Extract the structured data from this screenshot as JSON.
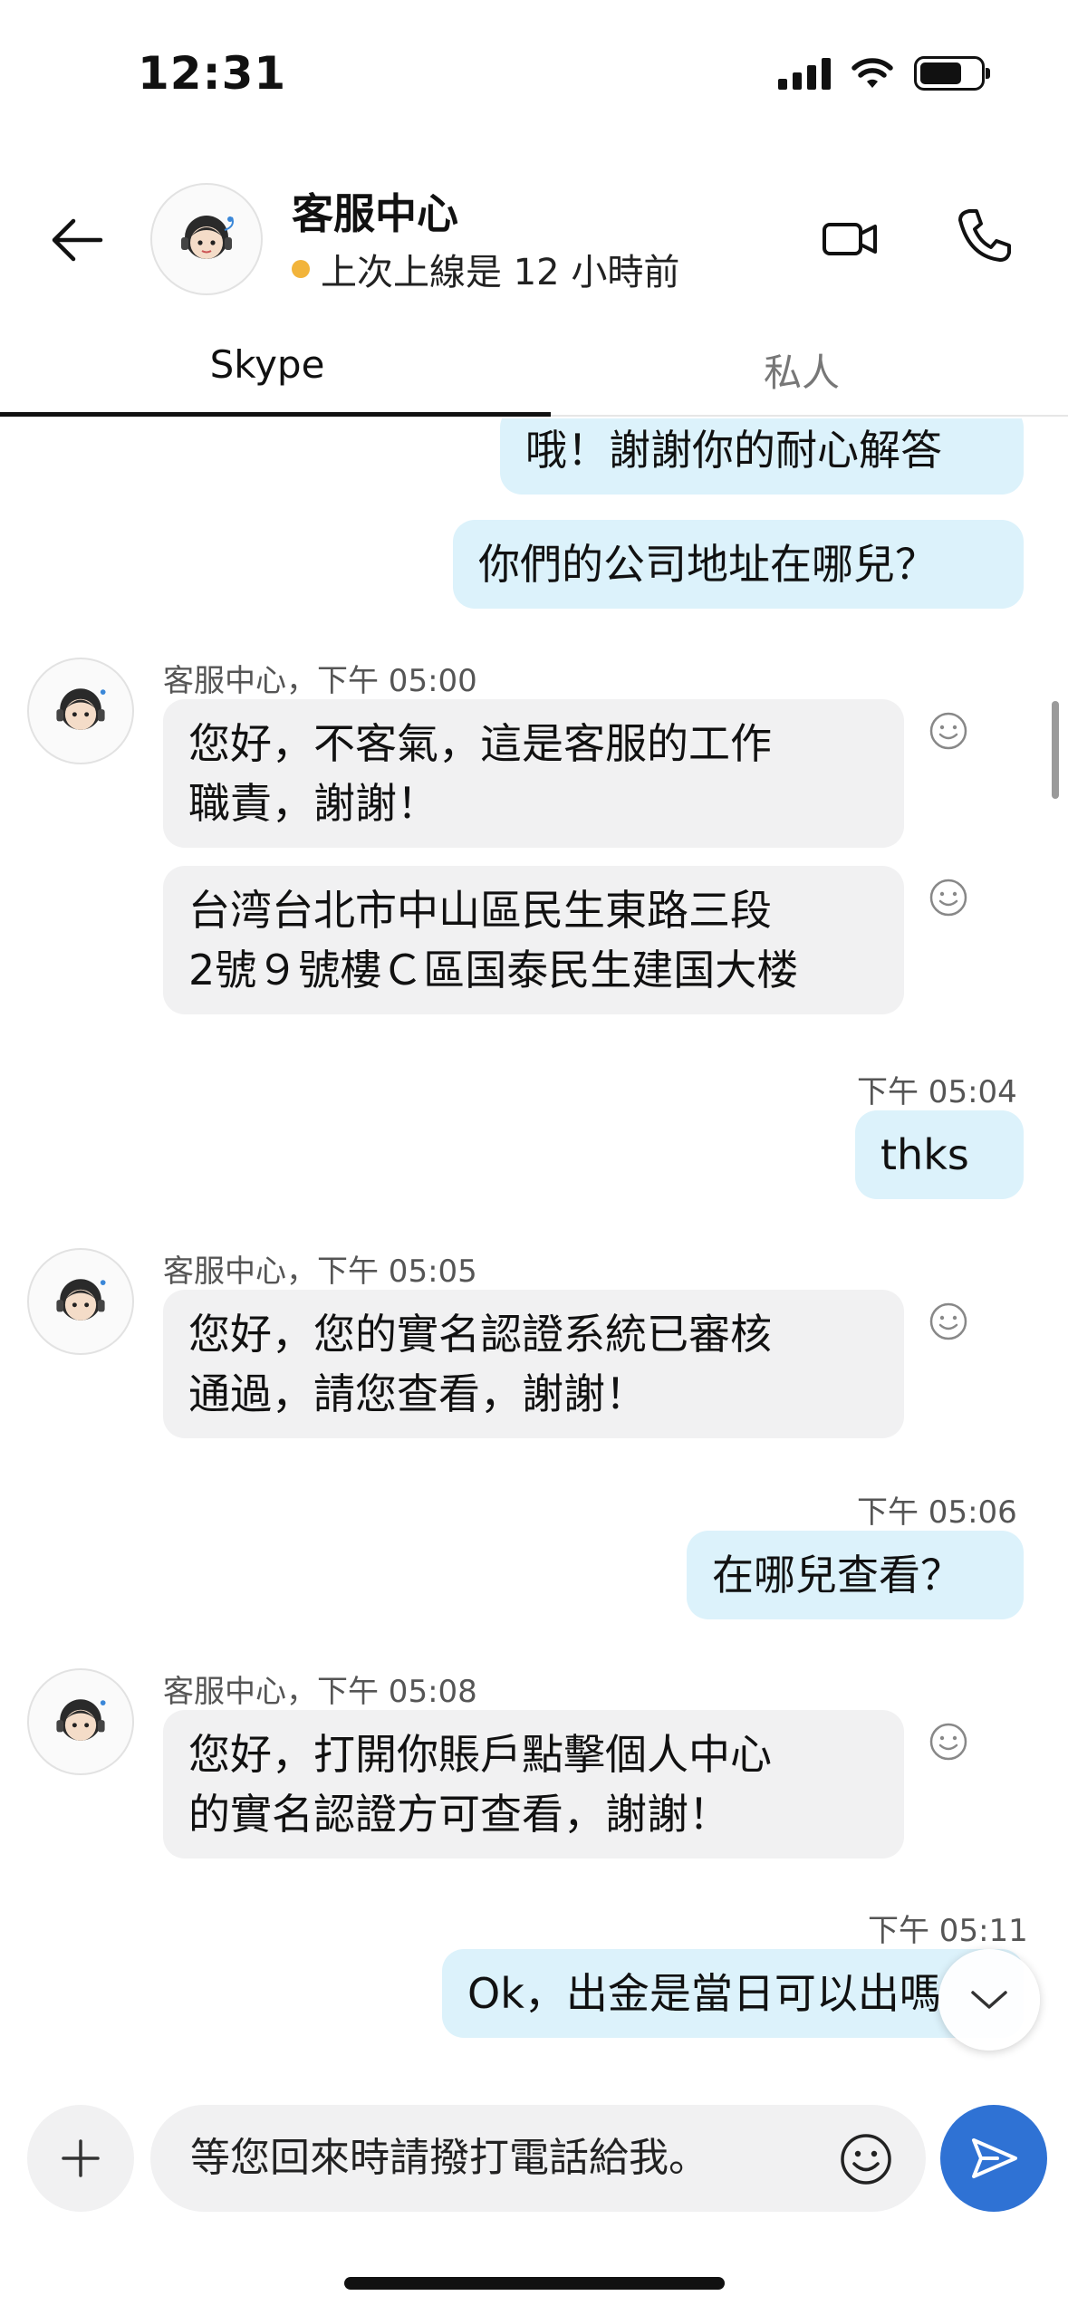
{
  "status_bar": {
    "time": "12:31",
    "icons": [
      "signal-icon",
      "wifi-icon",
      "battery-icon"
    ]
  },
  "header": {
    "title": "客服中心",
    "status": "上次上線是 12 小時前",
    "presence_color": "#f2b43b",
    "icons": [
      "back-arrow-icon",
      "video-call-icon",
      "phone-call-icon"
    ]
  },
  "tabs": [
    {
      "label": "Skype",
      "active": true
    },
    {
      "label": "私人",
      "active": false
    }
  ],
  "messages": {
    "m1": {
      "text": "哦！謝謝你的耐心解答",
      "direction": "out"
    },
    "m2": {
      "text": "你們的公司地址在哪兒？",
      "direction": "out"
    },
    "g1_meta": "客服中心，下午 05:00",
    "m3": {
      "line1": "您好，不客氣，這是客服的工作",
      "line2": "職責，謝謝！",
      "direction": "in"
    },
    "m4": {
      "line1": "台湾台北市中山區民生東路三段",
      "line2": "2號９號樓Ｃ區国泰民生建国大楼",
      "direction": "in"
    },
    "m5_time": "下午 05:04",
    "m5": {
      "text": "thks",
      "direction": "out"
    },
    "g2_meta": "客服中心，下午 05:05",
    "m6": {
      "line1": "您好，您的實名認證系統已審核",
      "line2": "通過，請您查看，謝謝！",
      "direction": "in"
    },
    "m7_time": "下午 05:06",
    "m7": {
      "text": "在哪兒查看？",
      "direction": "out"
    },
    "g3_meta": "客服中心，下午 05:08",
    "m8": {
      "line1": "您好，打開你賬戶點擊個人中心",
      "line2": "的實名認證方可查看，謝謝！",
      "direction": "in"
    },
    "m9_time": "下午 05:11",
    "m9": {
      "text": "Ok，出金是當日可以出嗎",
      "direction": "out"
    }
  },
  "composer": {
    "input_value": "等您回來時請撥打電話給我。",
    "icons": [
      "plus-icon",
      "emoji-icon",
      "send-icon"
    ]
  },
  "colors": {
    "outgoing_bubble": "#dcf2fb",
    "incoming_bubble": "#f1f1f2",
    "send_button": "#2f72d4"
  }
}
